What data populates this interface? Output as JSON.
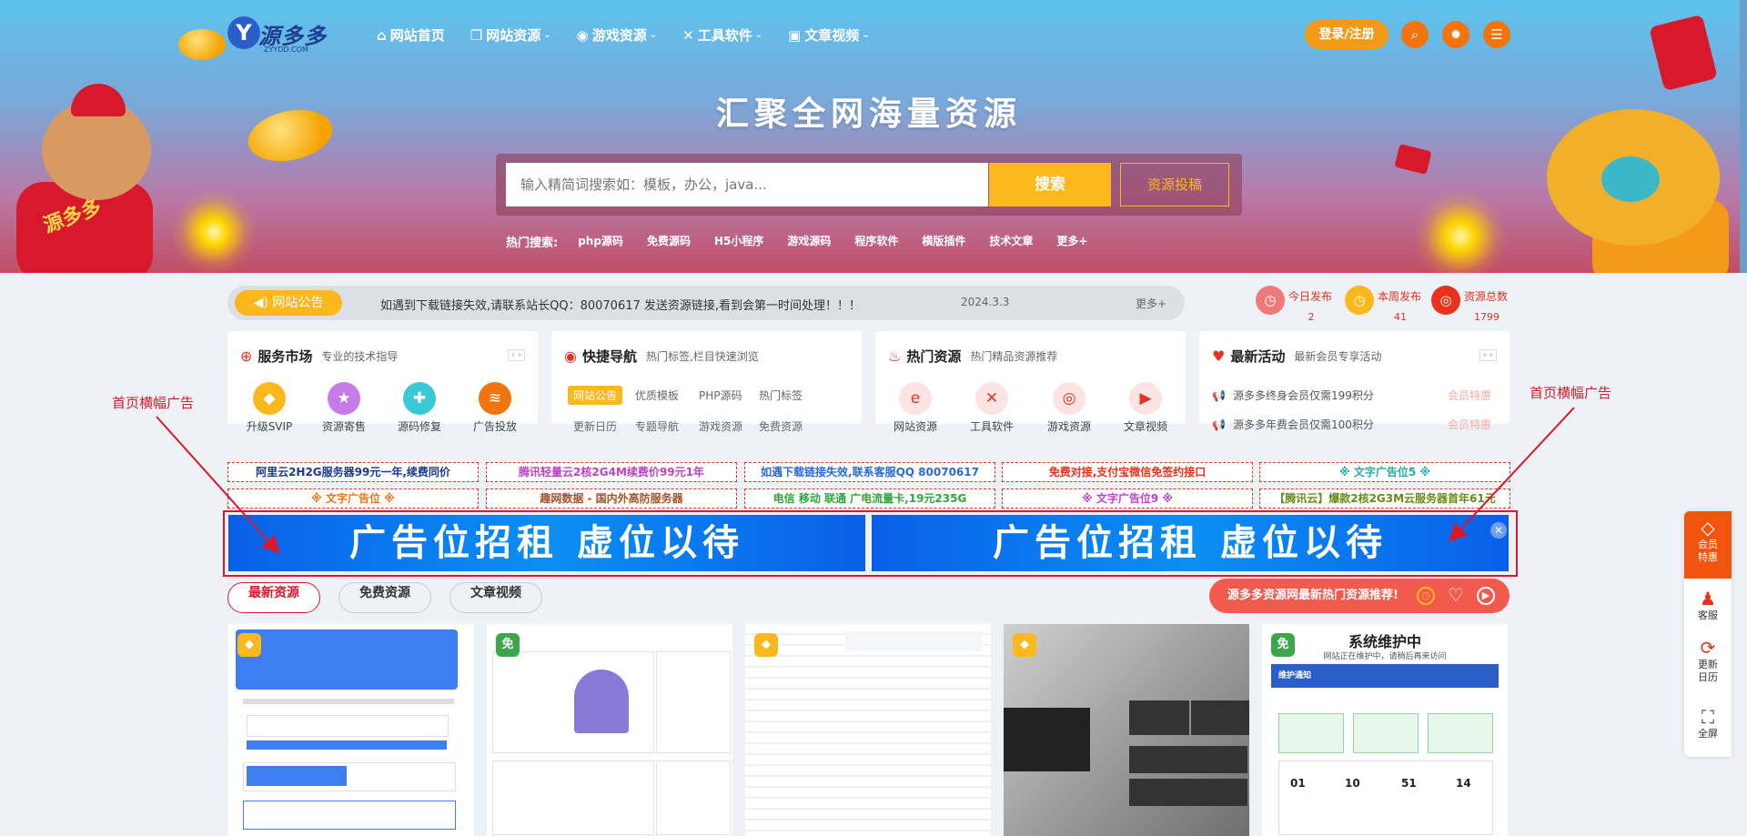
{
  "site": {
    "logo_text": "源多多",
    "logo_sub": "ZYYDD.COM",
    "hero_title": "汇聚全网海量资源"
  },
  "nav": {
    "items": [
      {
        "label": "网站首页",
        "icon": "home-icon",
        "has_dropdown": false
      },
      {
        "label": "网站资源",
        "icon": "code-icon",
        "has_dropdown": true
      },
      {
        "label": "游戏资源",
        "icon": "gamepad-icon",
        "has_dropdown": true
      },
      {
        "label": "工具软件",
        "icon": "tools-icon",
        "has_dropdown": true
      },
      {
        "label": "文章视频",
        "icon": "video-icon",
        "has_dropdown": true
      }
    ],
    "login_label": "登录/注册"
  },
  "search": {
    "placeholder": "输入精简词搜索如：模板，办公，java...",
    "button_label": "搜索",
    "submit_label": "资源投稿",
    "hot_label": "热门搜索:",
    "hot_terms": [
      "php源码",
      "免费源码",
      "H5小程序",
      "游戏源码",
      "程序软件",
      "横版插件",
      "技术文章",
      "更多+"
    ]
  },
  "notice": {
    "tag": "网站公告",
    "text": "如遇到下载链接失效,请联系站长QQ：80070617 发送资源链接,看到会第一时间处理！！！",
    "date": "2024.3.3",
    "more": "更多+"
  },
  "stats": [
    {
      "label": "今日发布",
      "value": "2",
      "color": "#f07a7a"
    },
    {
      "label": "本周发布",
      "value": "41",
      "color": "#fbb81c"
    },
    {
      "label": "资源总数",
      "value": "1799",
      "color": "#e8321d"
    }
  ],
  "cards": {
    "service": {
      "title": "服务市场",
      "subtitle": "专业的技术指导",
      "items": [
        {
          "label": "升级SVIP",
          "color": "#fbb81c"
        },
        {
          "label": "资源寄售",
          "color": "#c57be8"
        },
        {
          "label": "源码修复",
          "color": "#39c8d6"
        },
        {
          "label": "广告投放",
          "color": "#f2740f"
        }
      ]
    },
    "quicknav": {
      "title": "快捷导航",
      "subtitle": "热门标签,栏目快速浏览",
      "tags_row1": [
        "网站公告",
        "优质模板",
        "PHP源码",
        "热门标签"
      ],
      "tags_row2": [
        "更新日历",
        "专题导航",
        "游戏资源",
        "免费资源"
      ]
    },
    "hot": {
      "title": "热门资源",
      "subtitle": "热门精品资源推荐",
      "items": [
        {
          "label": "网站资源"
        },
        {
          "label": "工具软件"
        },
        {
          "label": "游戏资源"
        },
        {
          "label": "文章视频"
        }
      ]
    },
    "activity": {
      "title": "最新活动",
      "subtitle": "最新会员专享活动",
      "items": [
        {
          "text": "源多多终身会员仅需199积分",
          "tag": "会员特惠"
        },
        {
          "text": "源多多年费会员仅需100积分",
          "tag": "会员特惠"
        }
      ]
    }
  },
  "text_ads": [
    {
      "text": "阿里云2H2G服务器99元一年,续费同价",
      "color": "#1a3a8f"
    },
    {
      "text": "腾讯轻量云2核2G4M续费价99元1年",
      "color": "#c040c8"
    },
    {
      "text": "如遇下载链接失效,联系客服QQ 80070617",
      "color": "#2a6ad8"
    },
    {
      "text": "免费对接,支付宝微信免签约接口",
      "color": "#e8321d"
    },
    {
      "text": "※ 文字广告位5 ※",
      "color": "#2aa8a8"
    },
    {
      "text": "※ 文字广告位 ※",
      "color": "#f2740f"
    },
    {
      "text": "趣网数据 - 国内外高防服务器",
      "color": "#a0522d"
    },
    {
      "text": "电信 移动 联通 广电流量卡,19元235G",
      "color": "#2aa840"
    },
    {
      "text": "※ 文字广告位9 ※",
      "color": "#c040c8"
    },
    {
      "text": "【腾讯云】爆款2核2G3M云服务器首年61元",
      "color": "#6a8a1a"
    }
  ],
  "banners": [
    "广告位招租 虚位以待",
    "广告位招租 虚位以待"
  ],
  "annotations": {
    "left": "首页横幅广告",
    "right": "首页横幅广告"
  },
  "tabs": [
    "最新资源",
    "免费资源",
    "文章视频"
  ],
  "promo": {
    "text": "源多多资源网最新热门资源推荐!"
  },
  "thumbs": [
    {
      "badge": "vip-gem-icon",
      "badge_color": "#fbb81c"
    },
    {
      "badge": "免",
      "badge_color": "#3aa84a"
    },
    {
      "badge": "vip-gem-icon",
      "badge_color": "#fbb81c"
    },
    {
      "badge": "vip-gem-icon",
      "badge_color": "#fbb81c"
    },
    {
      "badge": "免",
      "badge_color": "#3aa84a",
      "title": "系统维护中",
      "subtitle": "网站正在维护中，请稍后再来访问",
      "notice": "维护通知",
      "countdown": [
        "01",
        "10",
        "51",
        "14"
      ]
    }
  ],
  "sidebar": {
    "vip": "会员特惠",
    "items": [
      {
        "label": "客服",
        "icon": "service-bell-icon"
      },
      {
        "label": "更新日历",
        "icon": "refresh-icon"
      },
      {
        "label": "全屏",
        "icon": "fullscreen-icon"
      }
    ]
  }
}
